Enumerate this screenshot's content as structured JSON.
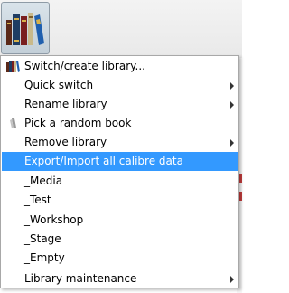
{
  "toolbar": {
    "library_button_icon": "books-icon"
  },
  "menu": {
    "highlight_color": "#3399ff",
    "items": [
      {
        "label": "Switch/create library...",
        "icon": "books-icon",
        "submenu": false
      },
      {
        "label": "Quick switch",
        "icon": "",
        "submenu": true
      },
      {
        "label": "Rename library",
        "icon": "",
        "submenu": true
      },
      {
        "label": "Pick a random book",
        "icon": "pick-random-icon",
        "submenu": false
      },
      {
        "label": "Remove library",
        "icon": "",
        "submenu": true
      },
      {
        "label": "Export/Import all calibre data",
        "icon": "",
        "submenu": false,
        "highlighted": true
      },
      {
        "label": "_Media",
        "icon": "",
        "submenu": false
      },
      {
        "label": "_Test",
        "icon": "",
        "submenu": false
      },
      {
        "label": "_Workshop",
        "icon": "",
        "submenu": false
      },
      {
        "label": "_Stage",
        "icon": "",
        "submenu": false
      },
      {
        "label": "_Empty",
        "icon": "",
        "submenu": false
      },
      {
        "label": "Library maintenance",
        "icon": "",
        "submenu": true
      }
    ]
  }
}
